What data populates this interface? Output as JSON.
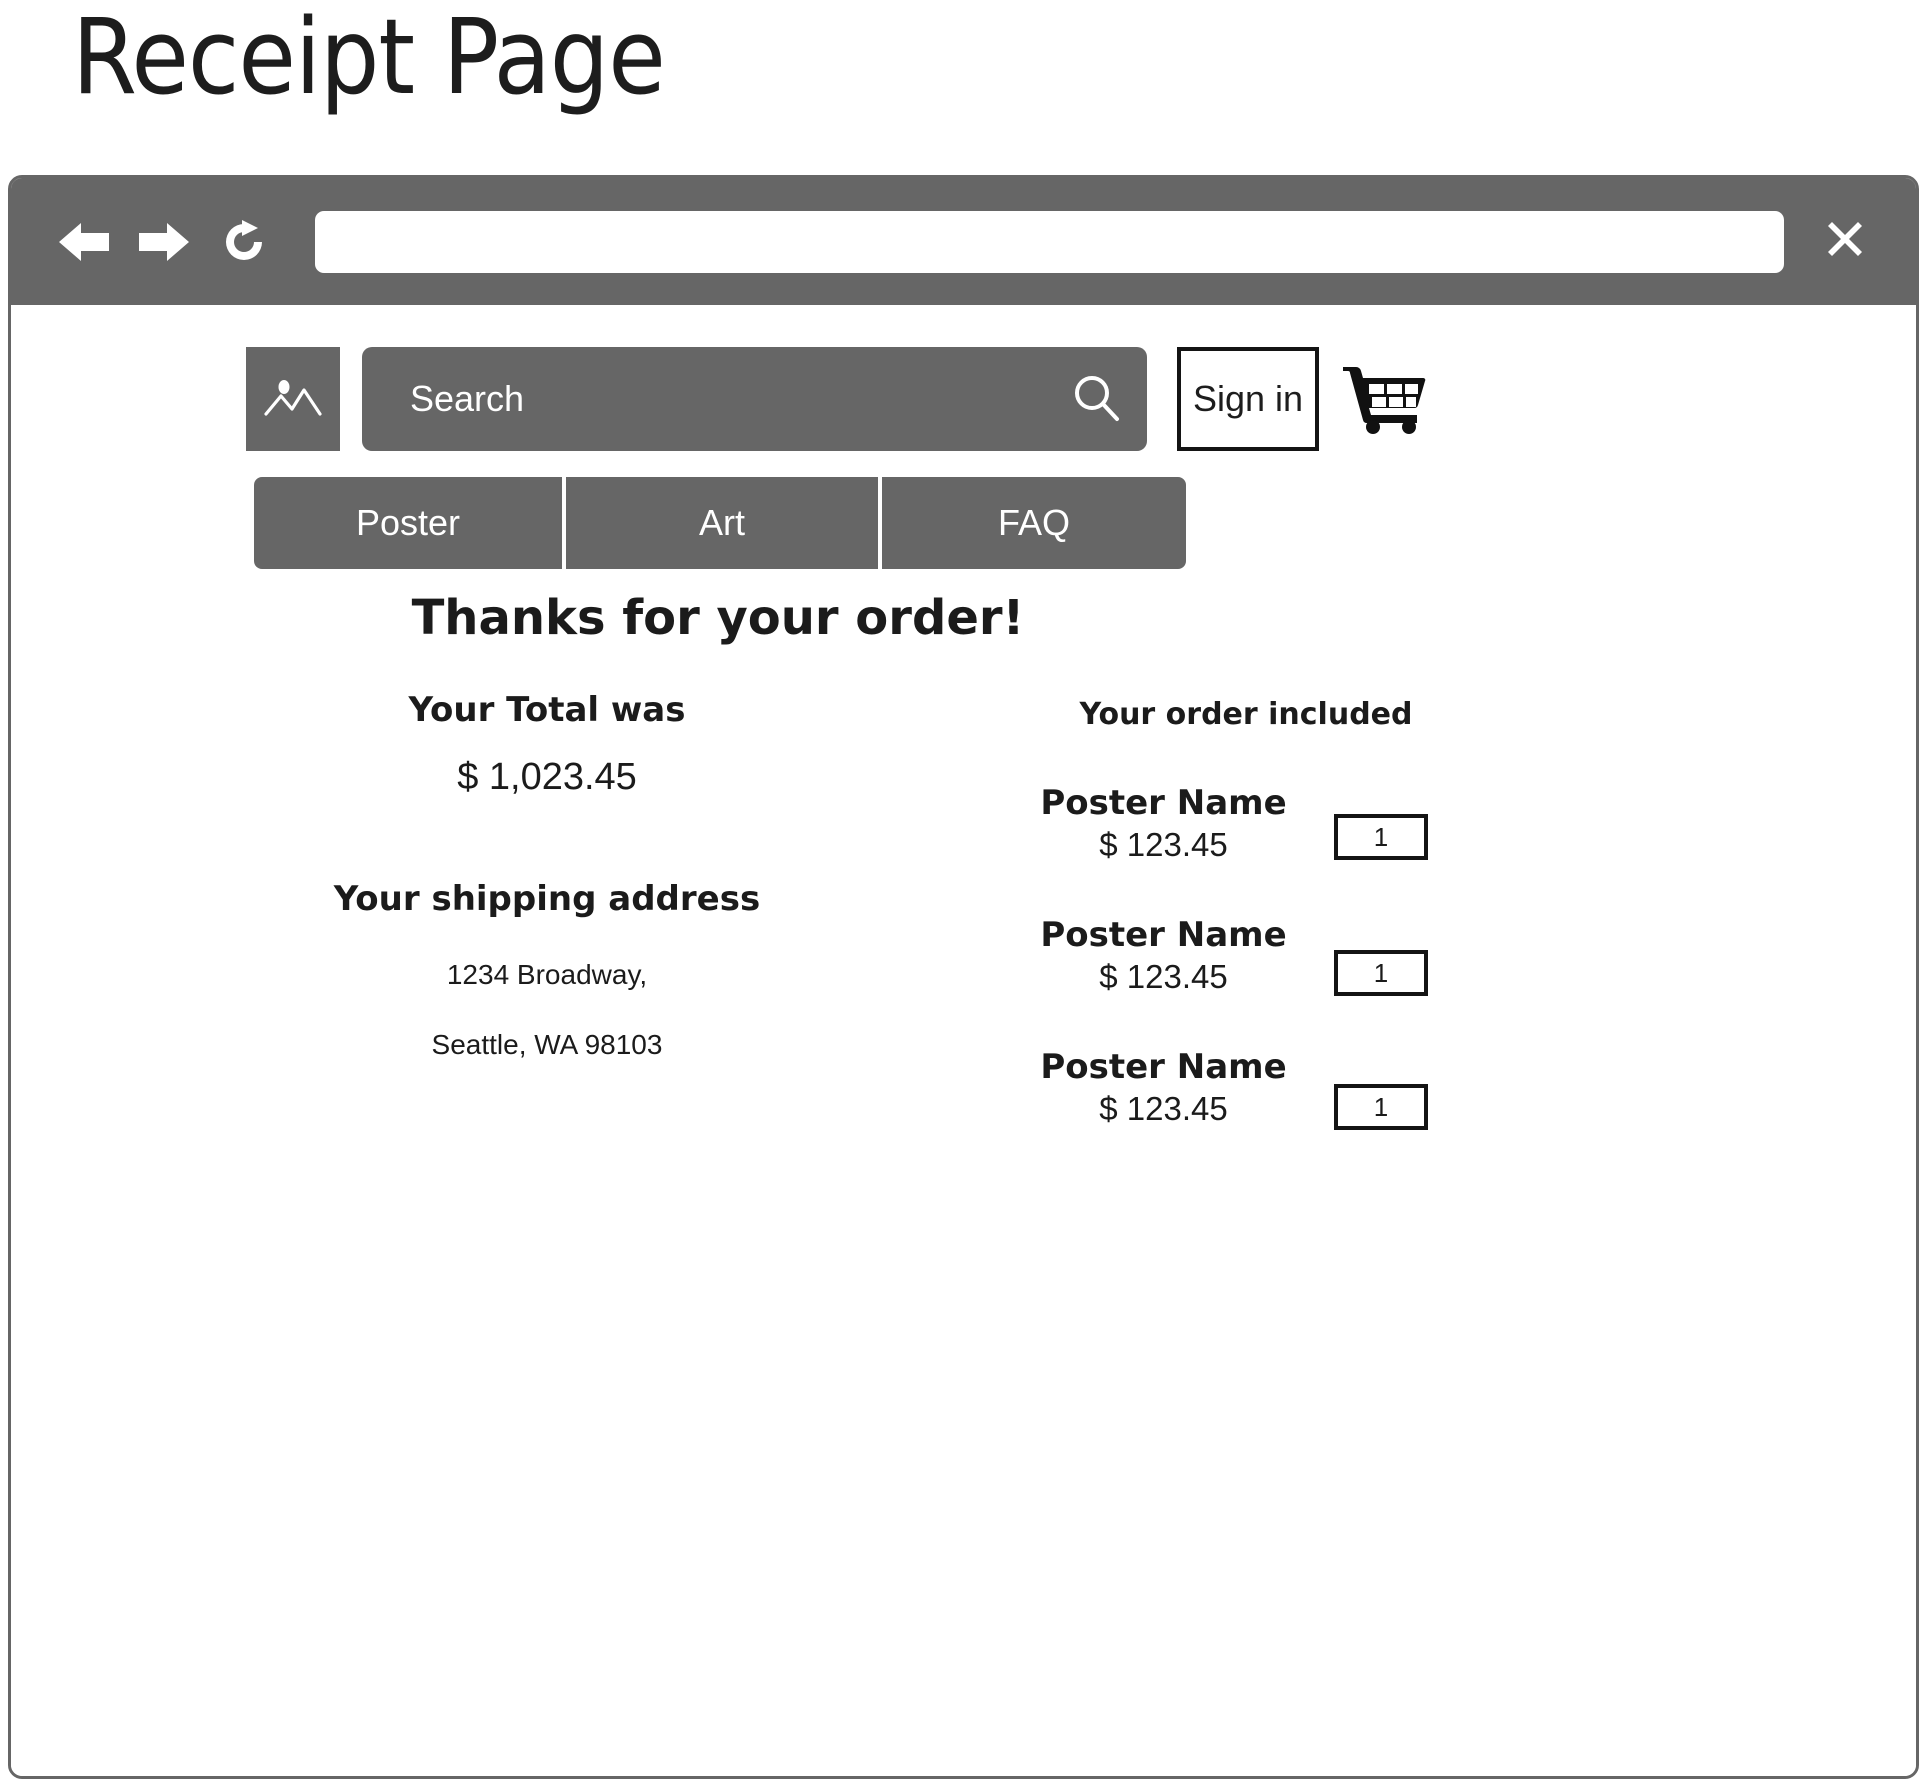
{
  "page": {
    "title": "Receipt Page"
  },
  "browser": {
    "back_icon": "arrow-left-icon",
    "forward_icon": "arrow-right-icon",
    "reload_icon": "reload-icon",
    "close_icon": "close-icon",
    "url_value": "",
    "url_placeholder": ""
  },
  "site_header": {
    "logo_icon": "mountain-image-icon",
    "search": {
      "placeholder": "Search",
      "value": "",
      "icon": "search-icon"
    },
    "signin_label": "Sign in",
    "cart_icon": "shopping-cart-icon"
  },
  "nav_tabs": [
    {
      "label": "Poster"
    },
    {
      "label": "Art"
    },
    {
      "label": "FAQ"
    }
  ],
  "main": {
    "headline": "Thanks for your order!",
    "total": {
      "title": "Your Total was",
      "amount": "$ 1,023.45"
    },
    "shipping": {
      "title": "Your shipping address",
      "line1": "1234 Broadway,",
      "line2": "Seattle, WA 98103"
    },
    "order": {
      "title": "Your order included",
      "items": [
        {
          "name": "Poster Name",
          "price": "$ 123.45",
          "qty": "1"
        },
        {
          "name": "Poster Name",
          "price": "$ 123.45",
          "qty": "1"
        },
        {
          "name": "Poster Name",
          "price": "$ 123.45",
          "qty": "1"
        }
      ]
    }
  },
  "colors": {
    "chrome_gray": "#666666",
    "text_dark": "#1b1b1b",
    "white": "#ffffff"
  }
}
